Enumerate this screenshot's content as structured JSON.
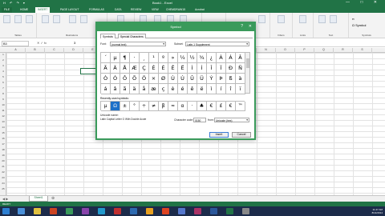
{
  "window": {
    "title": "Book1 - Excel",
    "quick_access": "H ↶ ↷ ▾",
    "controls": "— □ ✕"
  },
  "tabs": [
    "FILE",
    "HOME",
    "INSERT",
    "PAGE LAYOUT",
    "FORMULAS",
    "DATA",
    "REVIEW",
    "VIEW",
    "CHEMDRAW15",
    "Acrobat"
  ],
  "active_tab": "INSERT",
  "ribbon_groups": [
    {
      "label": "Tables"
    },
    {
      "label": "Illustrations"
    },
    {
      "label": "Apps"
    },
    {
      "label": "Charts"
    },
    {
      "label": "Reports"
    },
    {
      "label": "Sparklines"
    },
    {
      "label": "Filters"
    },
    {
      "label": "Links"
    },
    {
      "label": "Text"
    },
    {
      "label": "Symbols"
    }
  ],
  "ribbon_symbol_label": "Symbol",
  "formula_bar": {
    "name_box": "B3",
    "fx": "✕ ✓ fx",
    "value": "3"
  },
  "columns": [
    "A",
    "B",
    "C",
    "D",
    "E",
    "F",
    "G",
    "H",
    "I",
    "J",
    "K",
    "L",
    "M",
    "N",
    "O",
    "P",
    "Q",
    "R",
    "S"
  ],
  "rows": [
    "1",
    "2",
    "3",
    "4",
    "5",
    "6",
    "7",
    "8",
    "9",
    "10",
    "11",
    "12",
    "13",
    "14",
    "15",
    "16",
    "17",
    "18",
    "19",
    "20",
    "21",
    "22",
    "23",
    "24",
    "25"
  ],
  "selected_cell_value": "3",
  "sheet_tab": "Sheet1",
  "status": "READY",
  "clock": {
    "time": "11:47 AM",
    "date": "8/14/2014"
  },
  "dialog": {
    "title": "Symbol",
    "help": "?",
    "close": "✕",
    "tabs": [
      "Symbols",
      "Special Characters"
    ],
    "font_label": "Font:",
    "font_value": "(normal text)",
    "subset_label": "Subset:",
    "subset_value": "Latin-1 Supplement",
    "symbols": [
      "´",
      "µ",
      "¶",
      "·",
      "¸",
      "¹",
      "º",
      "»",
      "¼",
      "½",
      "¾",
      "¿",
      "À",
      "Á",
      "Â",
      "Ã",
      "Ä",
      "Å",
      "Æ",
      "Ç",
      "È",
      "É",
      "Ê",
      "Ë",
      "Ì",
      "Í",
      "Î",
      "Ï",
      "Ð",
      "Ñ",
      "Ò",
      "Ó",
      "Ô",
      "Õ",
      "Ö",
      "×",
      "Ø",
      "Ù",
      "Ú",
      "Û",
      "Ü",
      "Ý",
      "Þ",
      "ß",
      "à",
      "á",
      "â",
      "ã",
      "ä",
      "å",
      "æ",
      "ç",
      "è",
      "é",
      "ê",
      "ë",
      "ì",
      "í",
      "î",
      "ï"
    ],
    "recent_label": "Recently used symbols:",
    "recent": [
      "µ",
      "Ω",
      "±",
      "°",
      "÷",
      "≠",
      "β",
      "≈",
      "α",
      "·",
      "♣",
      "€",
      "£",
      "€",
      "™"
    ],
    "recent_selected_index": 1,
    "unicode_name_label": "Unicode name:",
    "unicode_name_value": "Latin Capital Letter O With Double Acute",
    "char_code_label": "Character code:",
    "char_code_value": "0150",
    "from_label": "from:",
    "from_value": "Unicode (hex)",
    "insert_label": "Insert",
    "cancel_label": "Cancel"
  }
}
